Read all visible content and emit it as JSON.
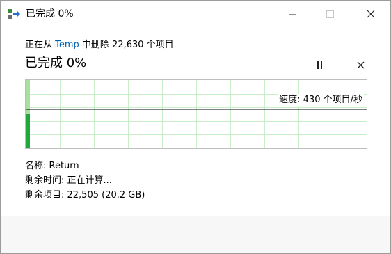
{
  "window": {
    "title": "已完成 0%"
  },
  "operation": {
    "prefix": "正在从 ",
    "source": "Temp",
    "suffix": " 中删除 22,630 个项目"
  },
  "progress": {
    "status_text": "已完成 0%",
    "percent": 0,
    "speed_label": "速度: 430 个项目/秒"
  },
  "details": {
    "name": "名称: Return",
    "time_remaining": "剩余时间: 正在计算...",
    "items_remaining": "剩余项目: 22,505 (20.2 GB)"
  },
  "colors": {
    "link": "#0063b1",
    "grid": "#c9efc9",
    "progress_fill": "#a8e0a0",
    "speed_bar": "#21a83c"
  },
  "icons": {
    "app": "copy-move-icon",
    "minimize": "minimize-icon",
    "maximize": "maximize-icon",
    "close": "close-icon",
    "pause": "pause-icon",
    "cancel": "cancel-icon"
  }
}
